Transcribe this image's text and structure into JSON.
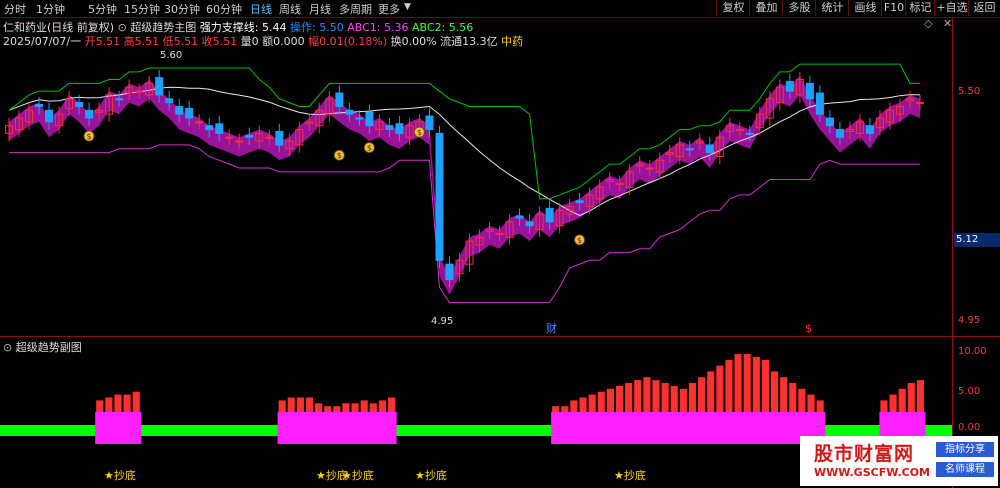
{
  "toolbar": {
    "periods": [
      "分时",
      "1分钟",
      "5分钟",
      "15分钟",
      "30分钟",
      "60分钟",
      "日线",
      "周线",
      "月线",
      "多周期",
      "更多"
    ],
    "active_period": "日线",
    "right_buttons": [
      "复权",
      "叠加",
      "多股",
      "统计",
      "画线",
      "F10",
      "标记",
      "+自选",
      "返回"
    ]
  },
  "header": {
    "stock": "仁和药业(日线 前复权)",
    "indicator": "超级趋势主图",
    "support_label": "强力支撑线:",
    "support_value": "5.44",
    "op_label": "操作:",
    "op_value": "5.50",
    "abc1_label": "ABC1:",
    "abc1_value": "5.36",
    "abc2_label": "ABC2:",
    "abc2_value": "5.56"
  },
  "quote": {
    "date": "2025/07/07/一",
    "open_label": "开",
    "open": "5.51",
    "high_label": "高",
    "high": "5.51",
    "low_label": "低",
    "low": "5.51",
    "close_label": "收",
    "close": "5.51",
    "vol_label": "量",
    "vol": "0",
    "amt_label": "额",
    "amt": "0.000",
    "chg_label": "幅",
    "chg": "0.01(0.18%)",
    "turnover_label": "换",
    "turnover": "0.00%",
    "float_label": "流通",
    "float": "13.3亿",
    "sector": "中药"
  },
  "main_axis": {
    "ticks": [
      "5.50",
      "4.95"
    ],
    "current": "5.12"
  },
  "chart_annotations": {
    "high_mark": "5.60",
    "low_mark": "4.95",
    "cai": "财",
    "dollar": "$"
  },
  "sub_panel": {
    "title": "超级趋势副图",
    "ticks": [
      "10.00",
      "5.00",
      "0.00"
    ],
    "chaodi_label": "★抄底"
  },
  "colors": {
    "up": "#ff3030",
    "down": "#1ea0ff",
    "magenta": "#ff20ff",
    "green": "#00ff00",
    "support": "#00c000"
  },
  "watermark": {
    "title": "股市财富网",
    "url": "WWW.GSCFW.COM",
    "tag1": "指标分享",
    "tag2": "名师课程"
  },
  "chart_data": {
    "type": "candlestick",
    "price_range": [
      4.95,
      5.6
    ],
    "sub_range": [
      0,
      10
    ],
    "closes": [
      5.45,
      5.47,
      5.49,
      5.5,
      5.46,
      5.48,
      5.52,
      5.5,
      5.47,
      5.49,
      5.53,
      5.52,
      5.55,
      5.54,
      5.56,
      5.53,
      5.51,
      5.48,
      5.47,
      5.46,
      5.44,
      5.43,
      5.42,
      5.41,
      5.42,
      5.43,
      5.42,
      5.4,
      5.41,
      5.44,
      5.46,
      5.49,
      5.52,
      5.5,
      5.48,
      5.47,
      5.45,
      5.46,
      5.44,
      5.43,
      5.45,
      5.46,
      5.44,
      5.1,
      5.05,
      5.1,
      5.15,
      5.16,
      5.18,
      5.17,
      5.2,
      5.21,
      5.19,
      5.22,
      5.2,
      5.23,
      5.24,
      5.25,
      5.27,
      5.29,
      5.31,
      5.3,
      5.33,
      5.35,
      5.34,
      5.36,
      5.38,
      5.4,
      5.39,
      5.41,
      5.38,
      5.42,
      5.45,
      5.44,
      5.43,
      5.48,
      5.52,
      5.55,
      5.54,
      5.57,
      5.52,
      5.48,
      5.45,
      5.42,
      5.44,
      5.46,
      5.43,
      5.47,
      5.49,
      5.5,
      5.52,
      5.51
    ],
    "sub_values": [
      0,
      0,
      0,
      0,
      0,
      0,
      0,
      0,
      0,
      0,
      2,
      2.5,
      3,
      3,
      3.5,
      0,
      0,
      0,
      0,
      0,
      0,
      0,
      0,
      0,
      0,
      0,
      0,
      0,
      0,
      0,
      2,
      2.5,
      2.5,
      2.5,
      1.5,
      1,
      1,
      1.5,
      1.5,
      2,
      1.5,
      2,
      2.5,
      0,
      0,
      0,
      0,
      0,
      0,
      0,
      0,
      0,
      0,
      0,
      0,
      0,
      0,
      0,
      0,
      0,
      1,
      1,
      2,
      2.5,
      3,
      3.5,
      4,
      4.5,
      5,
      5.5,
      6,
      5.5,
      5,
      4.5,
      4,
      5,
      6,
      7,
      8,
      9,
      10,
      10,
      9.5,
      9,
      7,
      6,
      5,
      4,
      3,
      2,
      0,
      0,
      0,
      0,
      0,
      0,
      2,
      3,
      4,
      5,
      5.5
    ],
    "chaodi_points": [
      1,
      26,
      29,
      34,
      50
    ]
  }
}
